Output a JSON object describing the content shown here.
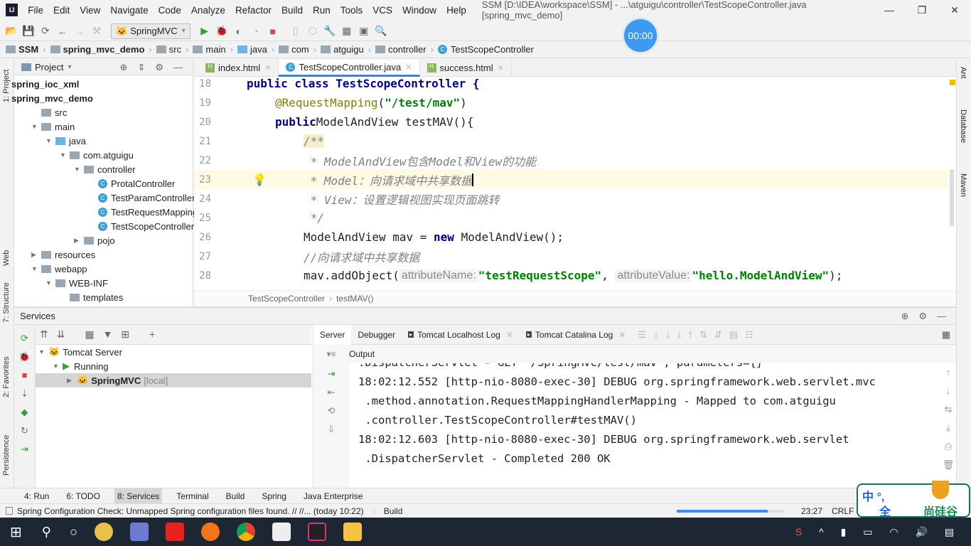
{
  "menu": {
    "items": [
      "File",
      "Edit",
      "View",
      "Navigate",
      "Code",
      "Analyze",
      "Refactor",
      "Build",
      "Run",
      "Tools",
      "VCS",
      "Window",
      "Help"
    ],
    "title": "SSM [D:\\IDEA\\workspace\\SSM] - ...\\atguigu\\controller\\TestScopeController.java [spring_mvc_demo]"
  },
  "toolbar": {
    "run_config": "SpringMVC",
    "timer": "00:00"
  },
  "breadcrumb": [
    "SSM",
    "spring_mvc_demo",
    "src",
    "main",
    "java",
    "com",
    "atguigu",
    "controller",
    "TestScopeController"
  ],
  "project": {
    "header": "Project",
    "tree": [
      {
        "label": "spring_ioc_xml",
        "bold": true
      },
      {
        "label": "spring_mvc_demo",
        "bold": true
      },
      {
        "label": "src"
      },
      {
        "label": "main"
      },
      {
        "label": "java"
      },
      {
        "label": "com.atguigu"
      },
      {
        "label": "controller"
      },
      {
        "label": "ProtalController"
      },
      {
        "label": "TestParamController"
      },
      {
        "label": "TestRequestMappingController"
      },
      {
        "label": "TestScopeController"
      },
      {
        "label": "pojo"
      },
      {
        "label": "resources"
      },
      {
        "label": "webapp"
      },
      {
        "label": "WEB-INF"
      },
      {
        "label": "templates"
      }
    ]
  },
  "left_strip": [
    "1: Project",
    "Web",
    "7: Structure",
    "2: Favorites",
    "Persistence"
  ],
  "right_strip": [
    "Ant",
    "Database",
    "Maven"
  ],
  "editor": {
    "tabs": [
      "index.html",
      "TestScopeController.java",
      "success.html"
    ],
    "active_tab": 1,
    "lines": [
      {
        "n": "18",
        "text": "public class TestScopeController {"
      },
      {
        "n": "19",
        "text": ""
      },
      {
        "n": "20",
        "text": ""
      },
      {
        "n": "21",
        "text": "/**"
      },
      {
        "n": "22",
        "text": " * ModelAndView包含Model和View的功能"
      },
      {
        "n": "23",
        "text": " * Model：向请求域中共享数据"
      },
      {
        "n": "24",
        "text": " * View：设置逻辑视图实现页面跳转"
      },
      {
        "n": "25",
        "text": " */"
      },
      {
        "n": "26",
        "text": ""
      },
      {
        "n": "27",
        "text": "//向请求域中共享数据"
      },
      {
        "n": "28",
        "text": ""
      }
    ],
    "annotation": "@RequestMapping",
    "mapping": "\"/test/mav\"",
    "method_sig": {
      "kw": "public",
      "rest": "ModelAndView testMAV(){"
    },
    "line26": {
      "a": "ModelAndView mav = ",
      "kw": "new",
      "b": " ModelAndView();"
    },
    "line28": {
      "a": "mav.addObject(",
      "h1": "attributeName:",
      "s1": "\"testRequestScope\"",
      "h2": "attributeValue:",
      "s2": "\"hello.ModelAndView\"",
      "b": ");"
    },
    "crumbs": [
      "TestScopeController",
      "testMAV()"
    ]
  },
  "services": {
    "title": "Services",
    "tree": [
      "Tomcat Server",
      "Running",
      "SpringMVC"
    ],
    "local": "[local]",
    "tabs": [
      "Server",
      "Debugger",
      "Tomcat Localhost Log",
      "Tomcat Catalina Log"
    ],
    "output_label": "Output",
    "output": [
      ".DispatcherServlet - GET \"/SpringMVC/test/mav\", parameters={}",
      "18:02:12.552 [http-nio-8080-exec-30] DEBUG org.springframework.web.servlet.mvc",
      " .method.annotation.RequestMappingHandlerMapping - Mapped to com.atguigu",
      " .controller.TestScopeController#testMAV()",
      "18:02:12.603 [http-nio-8080-exec-30] DEBUG org.springframework.web.servlet",
      " .DispatcherServlet - Completed 200 OK"
    ]
  },
  "bottom_tabs": [
    "4: Run",
    "6: TODO",
    "8: Services",
    "Terminal",
    "Build",
    "Spring",
    "Java Enterprise"
  ],
  "bottom_active": 2,
  "status": {
    "message": "Spring Configuration Check: Unmapped Spring configuration files found. // //... (today 10:22)",
    "task": "Build",
    "position": "23:27",
    "line_sep": "CRLF",
    "progress": 0.85
  },
  "ime": {
    "top": "中 °, ",
    "bottom": "全",
    "brand": "尚硅谷"
  }
}
